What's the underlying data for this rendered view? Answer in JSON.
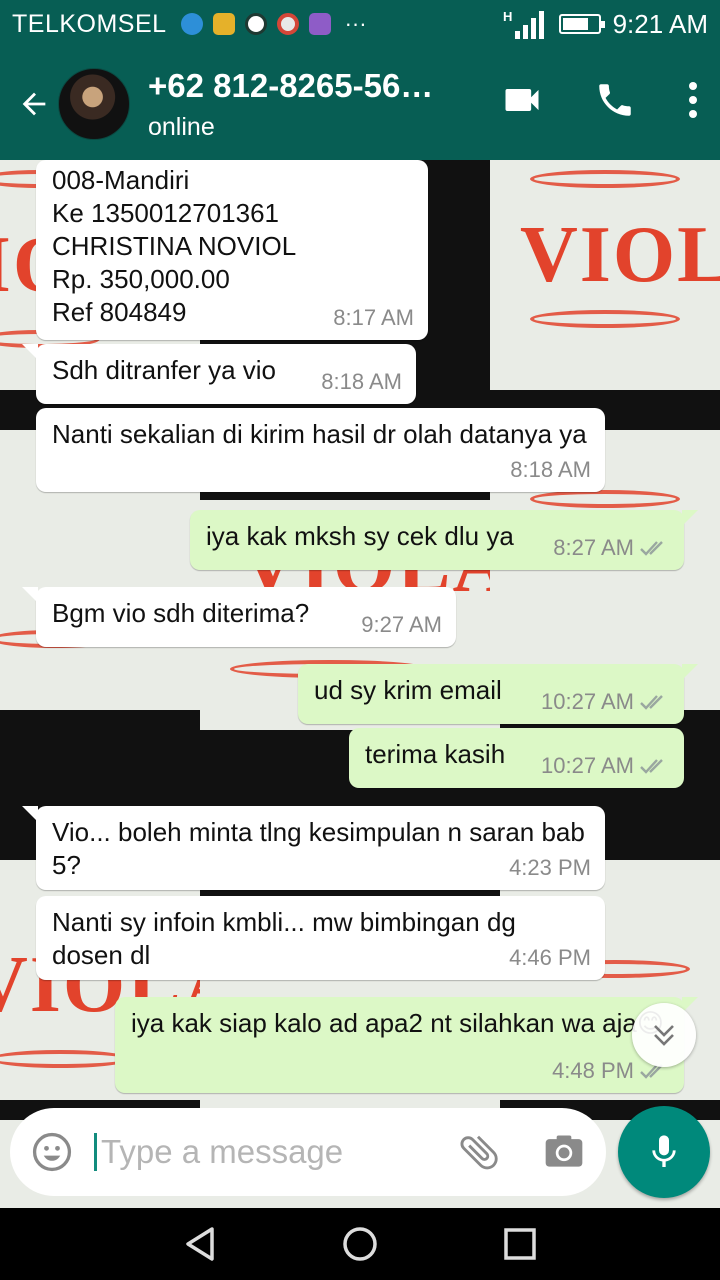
{
  "status_bar": {
    "carrier": "TELKOMSEL",
    "network": "H",
    "time": "9:21 AM",
    "more": "···",
    "battery_level": 0.75,
    "notification_icons": [
      "bbm-icon",
      "clipboard-icon",
      "starbucks-icon",
      "gmail-icon",
      "gallery-icon"
    ]
  },
  "header": {
    "contact_name": "+62 812-8265-56…",
    "presence": "online",
    "icons": [
      "back-arrow-icon",
      "video-call-icon",
      "phone-icon",
      "more-vert-icon"
    ]
  },
  "messages": [
    {
      "dir": "in",
      "text": "008-Mandiri\nKe 1350012701361\nCHRISTINA NOVIOL\nRp. 350,000.00\nRef 804849",
      "time": "8:17 AM"
    },
    {
      "dir": "in",
      "text": "Sdh ditranfer ya vio",
      "time": "8:18 AM"
    },
    {
      "dir": "in",
      "text": "Nanti sekalian di kirim hasil dr olah datanya ya",
      "time": "8:18 AM"
    },
    {
      "dir": "out",
      "text": "iya kak mksh sy cek dlu ya",
      "time": "8:27 AM"
    },
    {
      "dir": "in",
      "text": "Bgm vio sdh diterima?",
      "time": "9:27 AM"
    },
    {
      "dir": "out",
      "text": "ud sy krim email",
      "time": "10:27 AM"
    },
    {
      "dir": "out",
      "text": "terima kasih",
      "time": "10:27 AM"
    },
    {
      "dir": "in",
      "text": "Vio... boleh minta tlng kesimpulan n saran bab 5?",
      "time": "4:23 PM"
    },
    {
      "dir": "in",
      "text": "Nanti sy infoin kmbli... mw bimbingan dg dosen dl",
      "time": "4:46 PM"
    },
    {
      "dir": "out",
      "text": "iya kak siap kalo ad apa2 nt silahkan wa aja😊",
      "time": "4:48 PM"
    }
  ],
  "input": {
    "placeholder": "Type a message",
    "icons": [
      "emoji-icon",
      "attach-icon",
      "camera-icon",
      "mic-icon"
    ]
  },
  "wallpaper": {
    "watermark": "VIOLA"
  },
  "colors": {
    "header": "#075e54",
    "outgoing_bubble": "#dcf8c6",
    "incoming_bubble": "#ffffff",
    "fab": "#00897b",
    "ticks": "#9aa7a0"
  }
}
